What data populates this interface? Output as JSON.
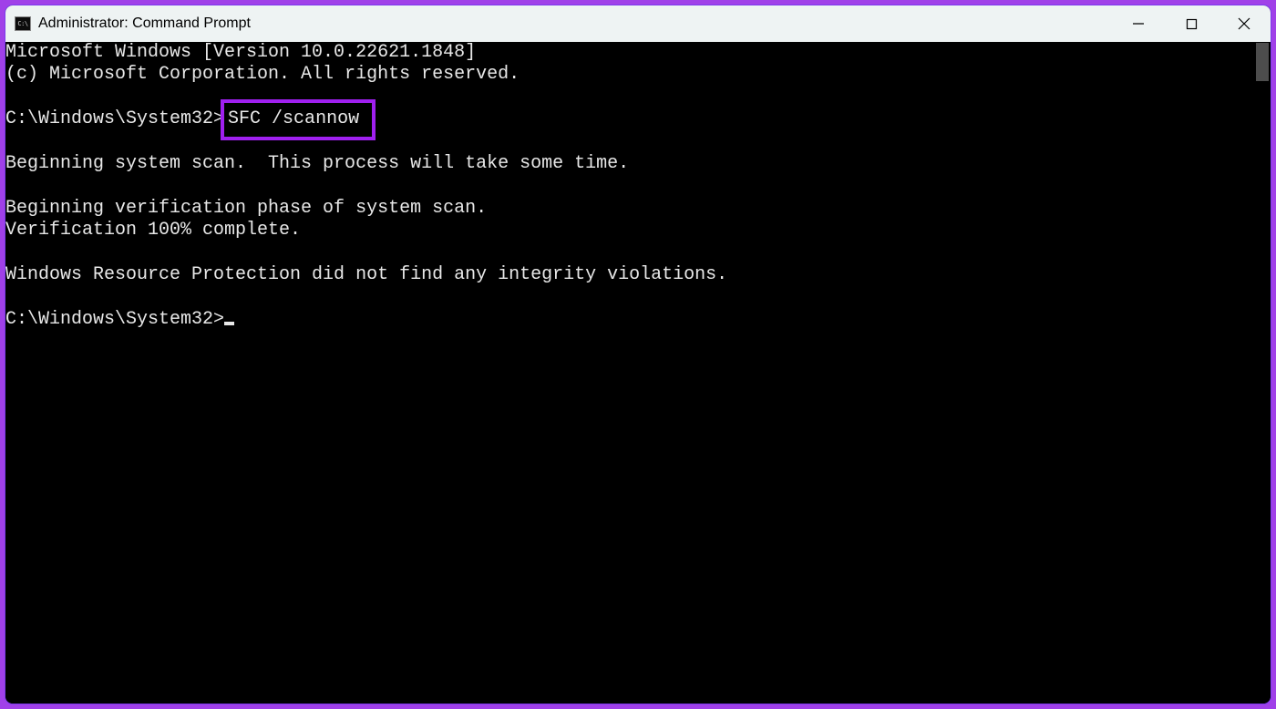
{
  "titlebar": {
    "icon_label": "C:\\",
    "title": "Administrator: Command Prompt"
  },
  "terminal": {
    "line_version": "Microsoft Windows [Version 10.0.22621.1848]",
    "line_copyright": "(c) Microsoft Corporation. All rights reserved.",
    "prompt1_path": "C:\\Windows\\System32>",
    "prompt1_command": "SFC /scannow",
    "line_begin_scan": "Beginning system scan.  This process will take some time.",
    "line_begin_verify": "Beginning verification phase of system scan.",
    "line_verify_complete": "Verification 100% complete.",
    "line_result": "Windows Resource Protection did not find any integrity violations.",
    "prompt2_path": "C:\\Windows\\System32>"
  },
  "annotation": {
    "highlight_color": "#a020f0"
  }
}
